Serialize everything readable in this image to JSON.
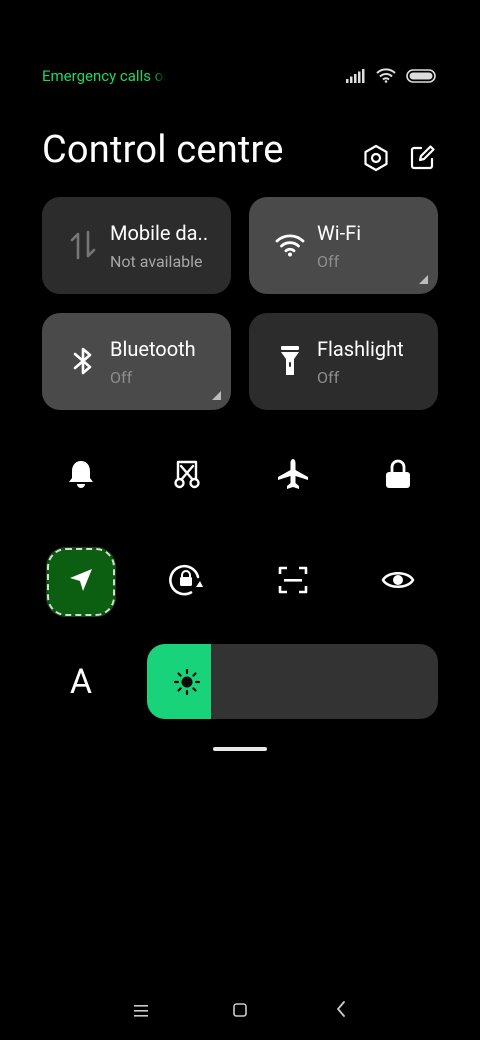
{
  "status_bar": {
    "carrier_text": "Emergency calls only",
    "carrier_color": "#1ed760",
    "icons": [
      "signal-icon",
      "wifi-icon",
      "battery-icon"
    ]
  },
  "header": {
    "title": "Control centre",
    "actions": [
      "settings-icon",
      "edit-icon"
    ]
  },
  "tiles": [
    {
      "label": "Mobile da..",
      "sub": "Not available",
      "icon": "mobile-data-icon",
      "active": false
    },
    {
      "label": "Wi-Fi",
      "sub": "Off",
      "icon": "wifi-icon",
      "active": true
    },
    {
      "label": "Bluetooth",
      "sub": "Off",
      "icon": "bluetooth-icon",
      "active": true
    },
    {
      "label": "Flashlight",
      "sub": "Off",
      "icon": "flashlight-icon",
      "active": false
    }
  ],
  "toggles_row1": [
    "bell-icon",
    "screenshot-icon",
    "airplane-icon",
    "lock-icon"
  ],
  "toggles_row2": [
    "location-icon",
    "rotation-lock-icon",
    "scan-icon",
    "eye-icon"
  ],
  "location_accent": "#0c5e10",
  "font_button_label": "A",
  "brightness": {
    "level": 0.22,
    "color": "#19d37b"
  },
  "nav": [
    "menu-icon",
    "home-icon",
    "back-icon"
  ]
}
